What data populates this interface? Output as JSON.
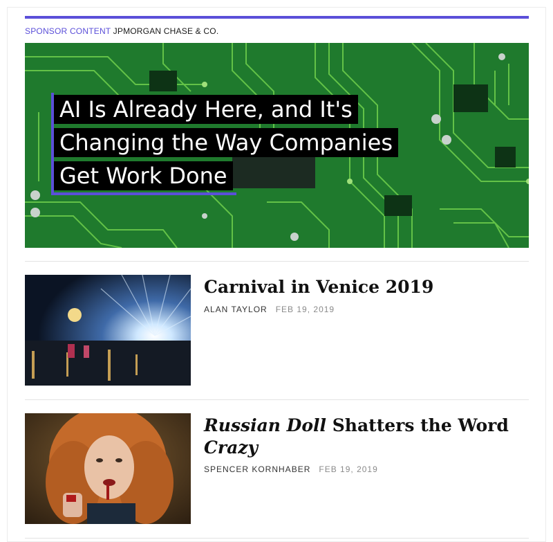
{
  "sponsor": {
    "tag": "SPONSOR CONTENT",
    "name": "JPMORGAN CHASE & CO."
  },
  "hero": {
    "title": "AI Is Already Here, and It's Changing the Way Companies Get Work Done"
  },
  "articles": [
    {
      "title": "Carnival in Venice 2019",
      "author": "ALAN TAYLOR",
      "date": "FEB 19, 2019"
    },
    {
      "title_italic_1": "Russian Doll",
      "title_middle": " Shatters the Word ",
      "title_italic_2": "Crazy",
      "author": "SPENCER KORNHABER",
      "date": "FEB 19, 2019"
    }
  ],
  "colors": {
    "accent": "#5b4fd9",
    "hero_bg": "#1f7a2d"
  }
}
